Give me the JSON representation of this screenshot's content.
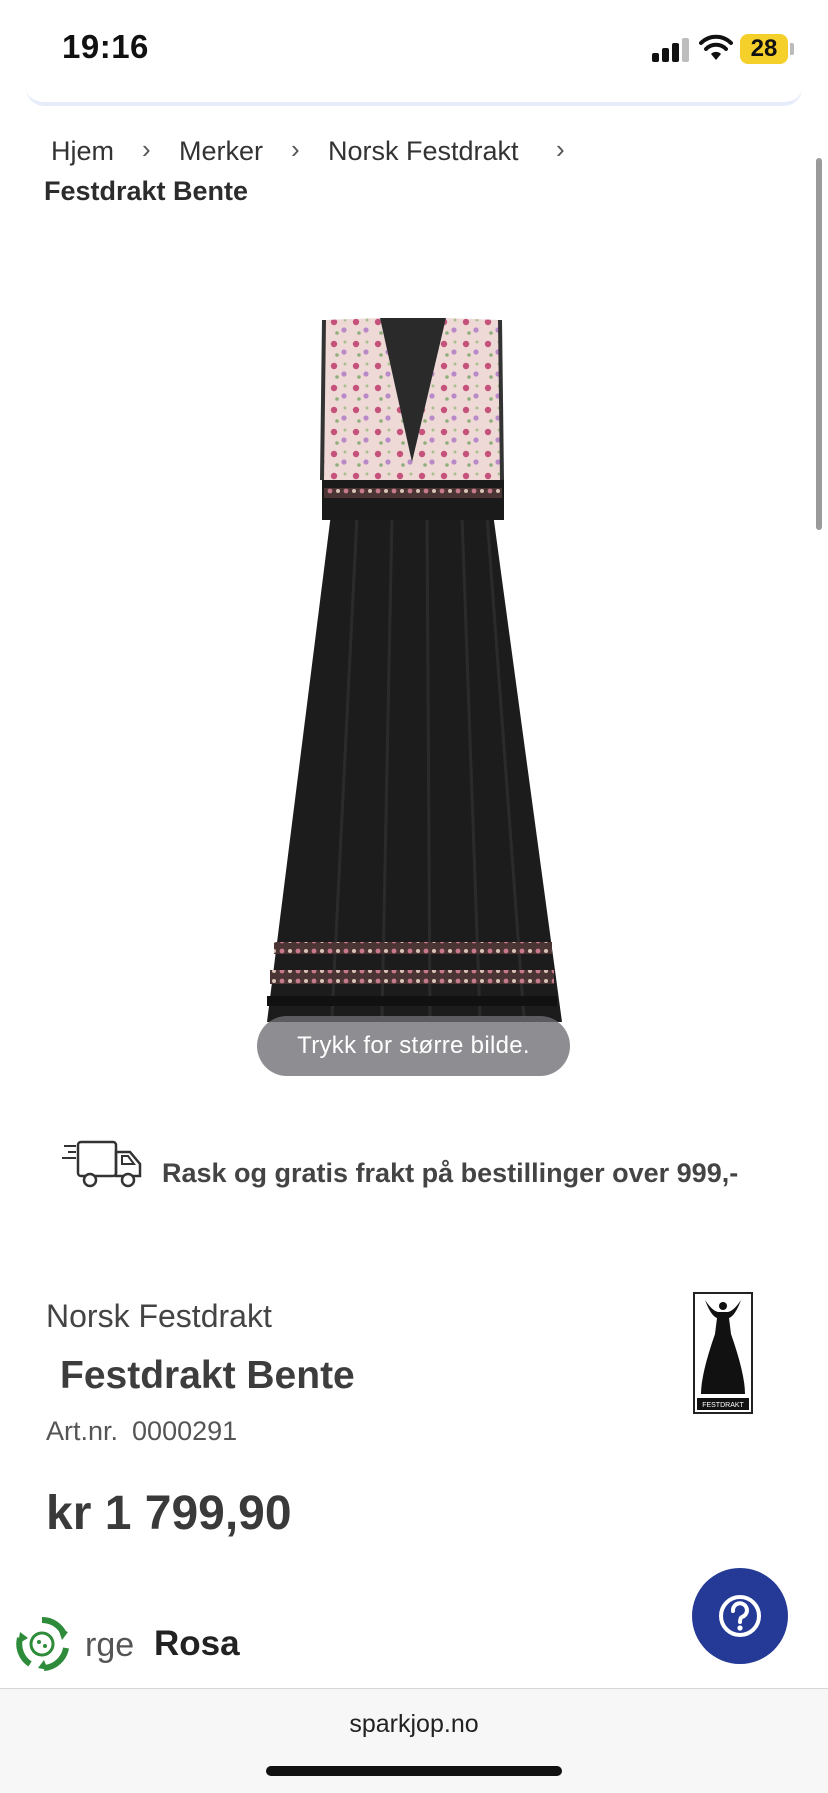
{
  "status_bar": {
    "time": "19:16",
    "battery": "28",
    "battery_color": "#f5d02a"
  },
  "breadcrumb": {
    "items": [
      "Hjem",
      "Merker",
      "Norsk Festdrakt"
    ],
    "separator": "›",
    "current": "Festdrakt Bente"
  },
  "gallery": {
    "hint": "Trykk for større bilde."
  },
  "shipping": {
    "icon": "delivery-truck-icon",
    "text": "Rask og gratis frakt på bestillinger over 999,-"
  },
  "product": {
    "brand": "Norsk Festdrakt",
    "title": "Festdrakt Bente",
    "art_label": "Art.nr.",
    "art_number": "0000291",
    "price": "kr 1 799,90",
    "logo_text": "FESTDRAKT"
  },
  "color": {
    "label": "rge",
    "value": "Rosa"
  },
  "help_button": {
    "icon": "question-mark-icon",
    "color": "#243a96"
  },
  "browser": {
    "url": "sparkjop.no"
  }
}
